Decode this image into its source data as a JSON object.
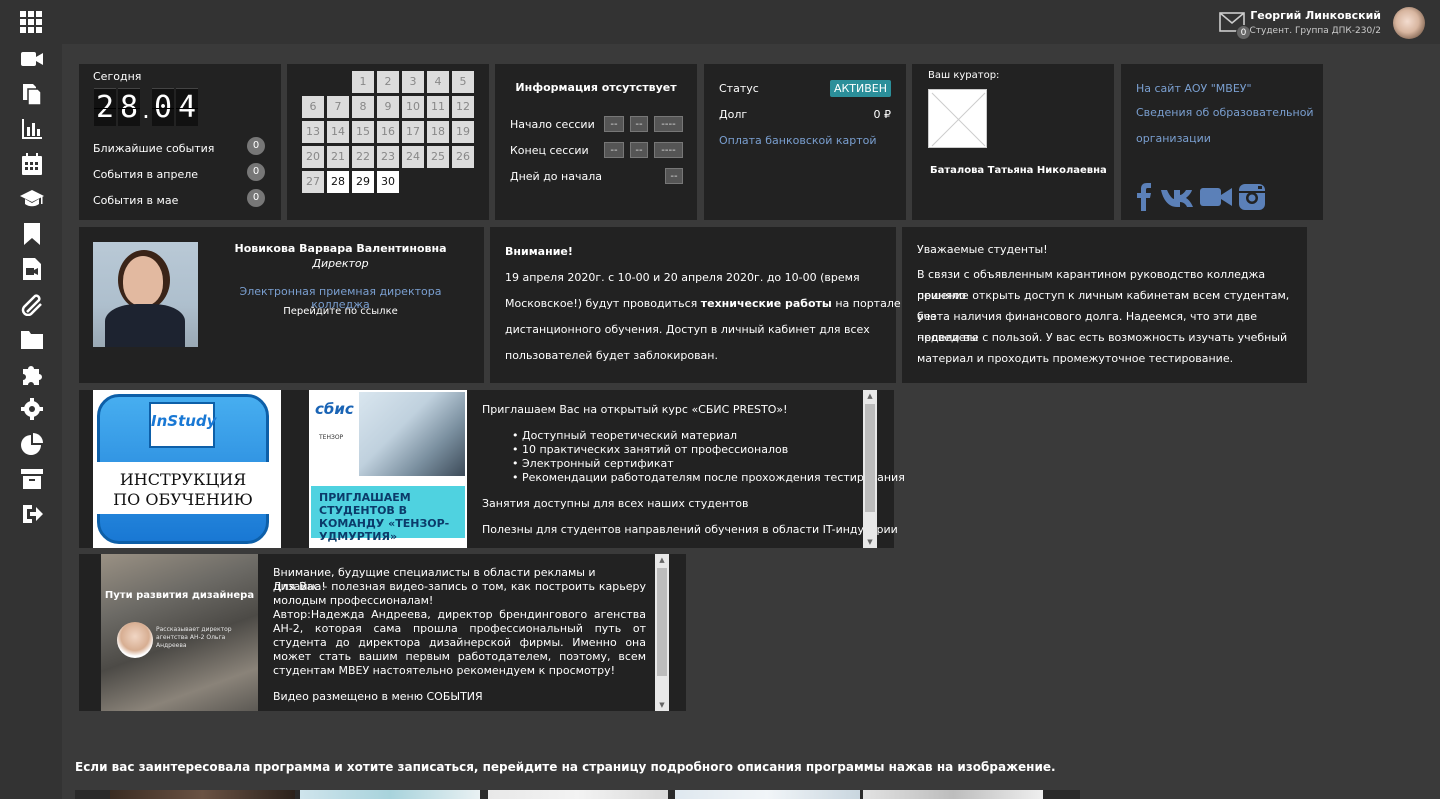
{
  "user": {
    "name": "Георгий Линковский",
    "subtitle": "Студент. Группа ДПК-230/2",
    "mail_count": "0"
  },
  "today": {
    "label": "Сегодня",
    "day": [
      "2",
      "8"
    ],
    "month": [
      "0",
      "4"
    ]
  },
  "events": [
    {
      "label": "Ближайшие события",
      "count": "0"
    },
    {
      "label": "События в апреле",
      "count": "0"
    },
    {
      "label": "События в мае",
      "count": "0"
    }
  ],
  "calendar": {
    "rows": [
      [
        "",
        "",
        "1",
        "2",
        "3",
        "4",
        "5"
      ],
      [
        "6",
        "7",
        "8",
        "9",
        "10",
        "11",
        "12"
      ],
      [
        "13",
        "14",
        "15",
        "16",
        "17",
        "18",
        "19"
      ],
      [
        "20",
        "21",
        "22",
        "23",
        "24",
        "25",
        "26"
      ],
      [
        "27",
        "28",
        "29",
        "30",
        "",
        "",
        ""
      ]
    ],
    "current_from": "28"
  },
  "session": {
    "title": "Информация отсутствует",
    "start_label": "Начало сессии",
    "end_label": "Конец сессии",
    "days_label": "Дней до начала",
    "dd": "--",
    "mm": "--",
    "yyyy": "----",
    "days": "--"
  },
  "status": {
    "status_label": "Статус",
    "status_value": "АКТИВЕН",
    "debt_label": "Долг",
    "debt_value": "0 ₽",
    "pay_link": "Оплата банковской картой"
  },
  "curator": {
    "label": "Ваш куратор:",
    "name": "Баталова Татьяна Николаевна"
  },
  "links": {
    "site": "На сайт АОУ \"МВЕУ\"",
    "info": "Сведения об образовательной организации"
  },
  "social": [
    "facebook-icon",
    "vk-icon",
    "video-icon",
    "instagram-icon"
  ],
  "director": {
    "name": "Новикова Варвара Валентиновна",
    "role": "Директор",
    "link": "Электронная приемная директора колледжа",
    "hint": "Перейдите по ссылке"
  },
  "notice": {
    "title": "Внимание!",
    "line1": "19 апреля 2020г. с 10-00 и 20 апреля 2020г. до 10-00 (время",
    "line2a": "Московское!) будут проводиться ",
    "line2b": "технические работы",
    "line2c": " на портале",
    "line3": "дистанционного обучения. Доступ в личный кабинет для всех",
    "line4": "пользователей будет заблокирован."
  },
  "students": {
    "title": "Уважаемые студенты!",
    "lines": [
      "В связи с объявленным карантином руководство колледжа приняло",
      "решение открыть доступ к личным кабинетам всем студентам, без",
      "учета наличия финансового долга. Надеемся, что эти две недели вы",
      "проведете с пользой. У вас есть возможность изучать учебный",
      "материал и проходить промежуточное тестирование."
    ]
  },
  "instudy": {
    "logo": "InStudy",
    "caption": [
      "ИНСТРУКЦИЯ",
      "ПО ОБУЧЕНИЮ"
    ]
  },
  "sbis": {
    "logo": "сбис",
    "logo_sub": "ТЕНЗОР",
    "banner": "ПРИГЛАШАЕМ СТУДЕНТОВ В КОМАНДУ «ТЕНЗОР-УДМУРТИЯ»",
    "intro": "Приглашаем Вас на открытый курс «СБИС PRESTO»!",
    "bullets": [
      "Доступный теоретический материал",
      "10 практических занятий от профессионалов",
      "Электронный сертификат",
      "Рекомендации работодателям после прохождения тестирования"
    ],
    "p1": "Занятия доступны для всех наших студентов",
    "p2": "Полезны для студентов направлений обучения в области IT-индустрии"
  },
  "design": {
    "img_title": "Пути развития дизайнера",
    "img_caption": "Рассказывает директор агентства АН-2 Ольга Андреева",
    "lines": [
      "Внимание, будущие специалисты в области рекламы и дизайна!",
      "Для Вас - полезная видео-запись о том, как построить карьеру молодым профессионалам!",
      "Автор:Надежда Андреева, директор брендингового агенства АН-2, которая сама прошла профессиональный путь от студента до директора дизайнерской фирмы. Именно она может стать вашим первым работодателем, поэтому, всем студентам МВЕУ настоятельно рекомендуем к просмотру!"
    ],
    "footer": "Видео размещено в меню СОБЫТИЯ"
  },
  "bottom_note": "Если вас заинтересовала программа и хотите записаться, перейдите на страницу подробного описания программы нажав на изображение.",
  "sidebar": [
    "video-icon",
    "documents-icon",
    "chart-icon",
    "calendar-icon",
    "graduation-icon",
    "bookmark-icon",
    "video-file-icon",
    "paperclip-icon",
    "folder-icon",
    "puzzle-icon",
    "settings-icon",
    "pie-chart-icon",
    "archive-icon",
    "logout-icon"
  ]
}
